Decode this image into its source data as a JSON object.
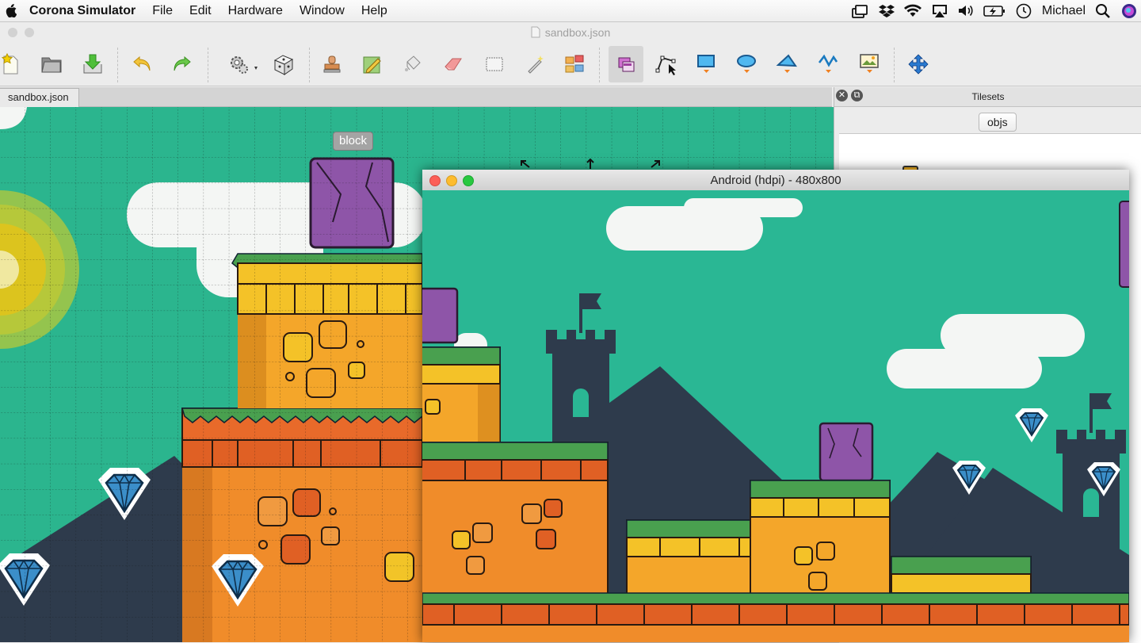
{
  "menubar": {
    "app_name": "Corona Simulator",
    "menus": [
      "File",
      "Edit",
      "Hardware",
      "Window",
      "Help"
    ],
    "user": "Michael",
    "status_icons": [
      "airdrop-icon",
      "dropbox-icon",
      "wifi-icon",
      "airplay-icon",
      "volume-icon",
      "battery-icon",
      "time-machine-icon",
      "spotlight-icon",
      "siri-icon"
    ]
  },
  "editor_window": {
    "title": "sandbox.json"
  },
  "toolbar": {
    "tools": [
      "new-file",
      "open-file",
      "save-file",
      "undo",
      "redo",
      "settings",
      "random",
      "stamp",
      "pencil",
      "bucket-fill",
      "eraser",
      "select-rectangle",
      "magic-wand",
      "tile-swap",
      "select-objects",
      "edit-polygon",
      "insert-rectangle",
      "insert-ellipse",
      "insert-polygon",
      "insert-polyline",
      "insert-image",
      "move"
    ],
    "selected_tool": "select-objects"
  },
  "document_tab": {
    "label": "sandbox.json"
  },
  "canvas": {
    "object_label": "block",
    "background_color": "#2bb58e"
  },
  "tilesets_panel": {
    "title": "Tilesets",
    "tileset_tab": "objs"
  },
  "simulator": {
    "title": "Android (hdpi) - 480x800"
  },
  "colors": {
    "teal": "#2bb58e",
    "orange": "#f0a020",
    "purple": "#8e55a8",
    "grass": "#49a04f",
    "gem": "#3b8ec9",
    "mountain": "#2e3b4c"
  }
}
